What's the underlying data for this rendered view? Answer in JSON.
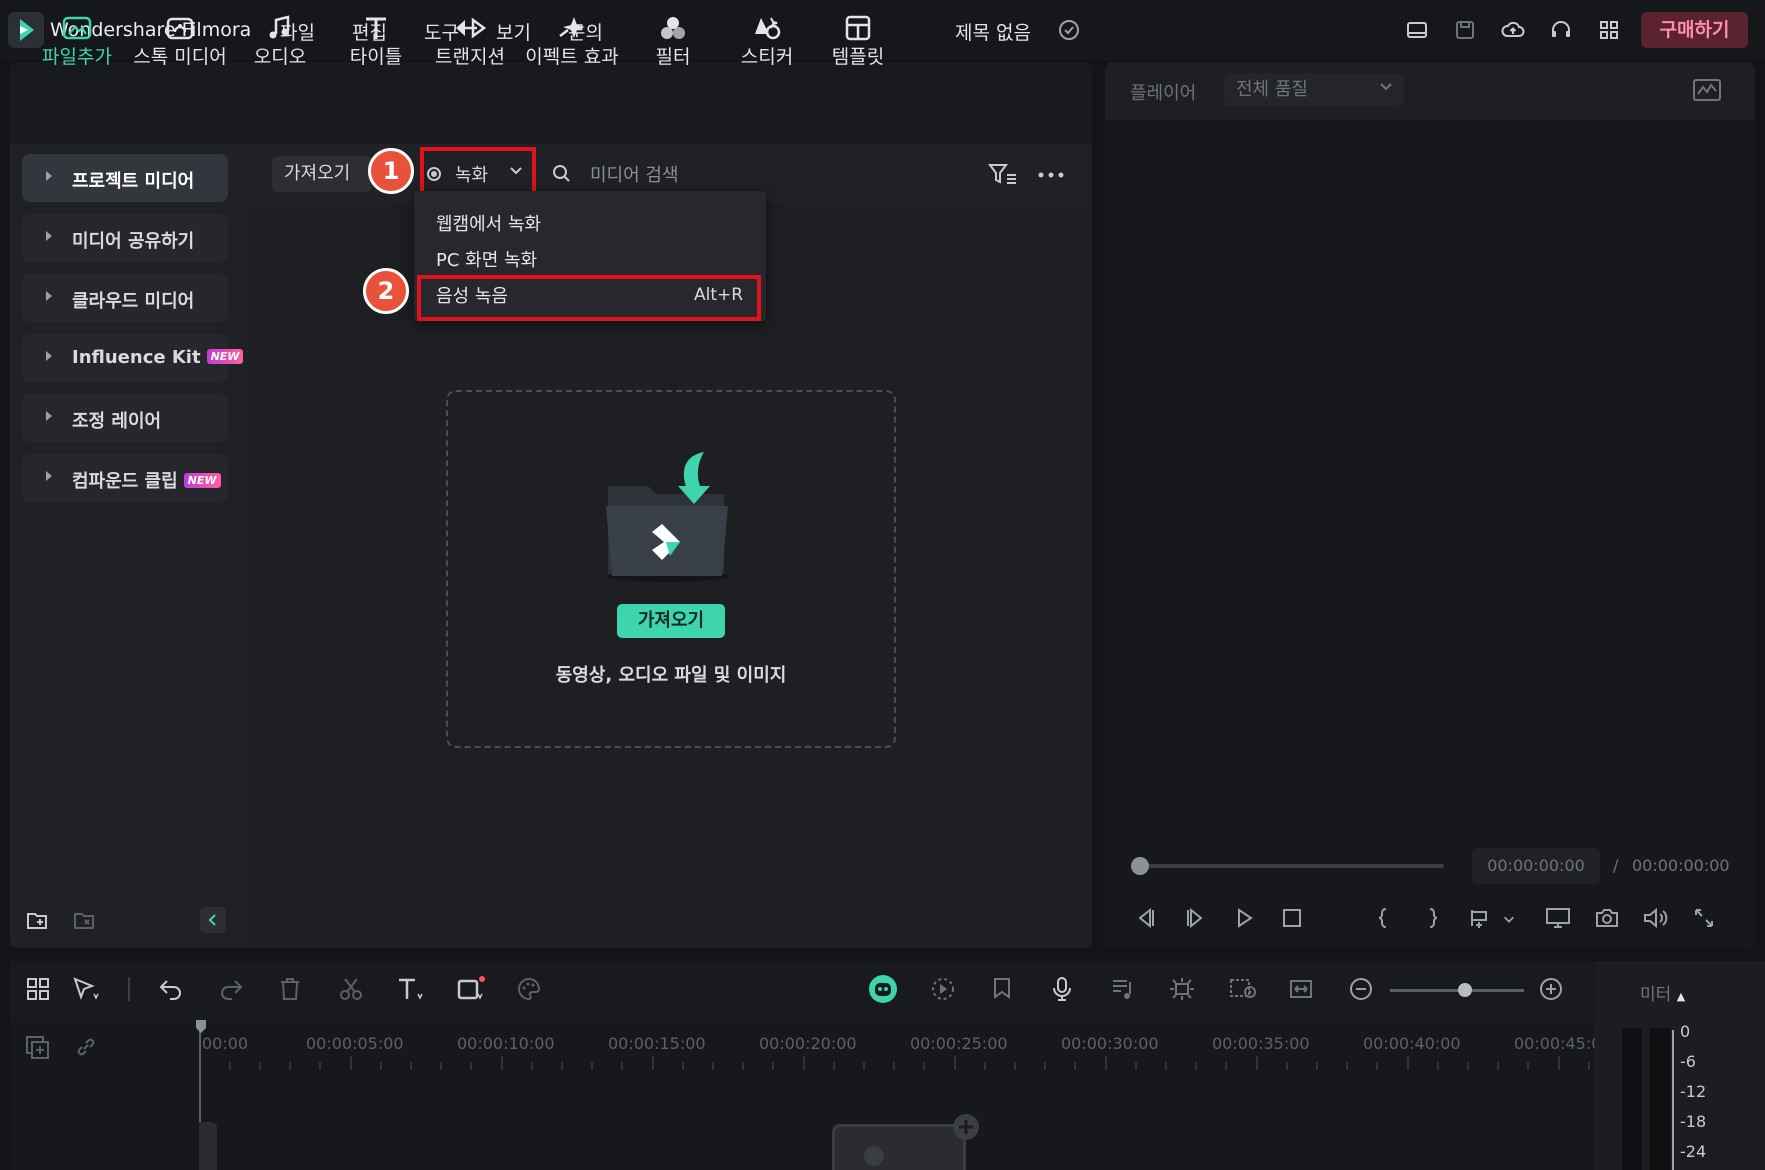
{
  "app": {
    "name": "Wondershare Filmora",
    "title": "제목 없음",
    "buy_label": "구매하기"
  },
  "menu": [
    "파일",
    "편집",
    "도구",
    "보기",
    "문의"
  ],
  "toolbar": [
    "파일추가",
    "스톡 미디어",
    "오디오",
    "타이틀",
    "트랜지션",
    "이펙트 효과",
    "필터",
    "스티커",
    "템플릿"
  ],
  "sidebar": [
    {
      "label": "프로젝트 미디어",
      "selected": true
    },
    {
      "label": "미디어 공유하기"
    },
    {
      "label": "클라우드 미디어"
    },
    {
      "label": "Influence Kit",
      "badge": "NEW"
    },
    {
      "label": "조정 레이어"
    },
    {
      "label": "컴파운드 클립",
      "badge": "NEW"
    }
  ],
  "media_bar": {
    "import_label": "가져오기",
    "record_label": "녹화",
    "search_placeholder": "미디어 검색"
  },
  "record_menu": {
    "items": [
      {
        "label": "웹캠에서 녹화"
      },
      {
        "label": "PC 화면 녹화"
      },
      {
        "label": "음성 녹음",
        "shortcut": "Alt+R"
      }
    ]
  },
  "steps": [
    "1",
    "2"
  ],
  "dropzone": {
    "button_label": "가져오기",
    "text": "동영상, 오디오 파일 및 이미지"
  },
  "player": {
    "label": "플레이어",
    "quality": "전체 품질",
    "current_time": "00:00:00:00",
    "separator": "/",
    "total_time": "00:00:00:00"
  },
  "timeline": {
    "ruler": [
      "00:00",
      "00:00:05:00",
      "00:00:10:00",
      "00:00:15:00",
      "00:00:20:00",
      "00:00:25:00",
      "00:00:30:00",
      "00:00:35:00",
      "00:00:40:00",
      "00:00:45:0"
    ],
    "zoom_level": 0.5
  },
  "meter": {
    "title": "미터",
    "scale": [
      "0",
      "-6",
      "-12",
      "-18",
      "-24"
    ]
  },
  "colors": {
    "accent": "#3ed4ad",
    "highlight": "#e0121b",
    "step": "#e9523a",
    "buy_bg": "#5b2231"
  }
}
